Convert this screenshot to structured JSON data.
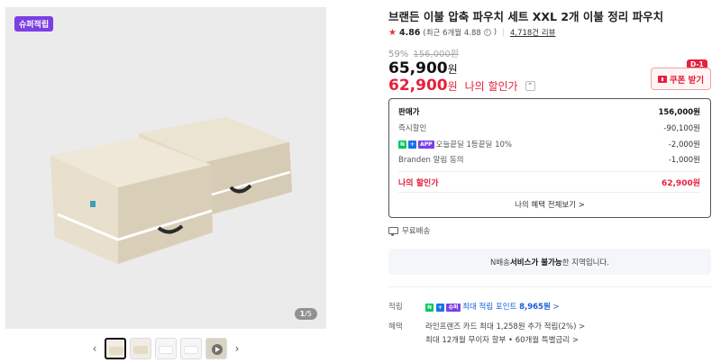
{
  "gallery": {
    "badge": "슈퍼적립",
    "counter_current": "1",
    "counter_total": "/5",
    "prev_icon": "chevron-left-icon",
    "next_icon": "chevron-right-icon",
    "thumbnails": [
      {
        "kind": "beige",
        "active": true
      },
      {
        "kind": "beige",
        "active": false
      },
      {
        "kind": "white",
        "active": false
      },
      {
        "kind": "white",
        "active": false
      },
      {
        "kind": "video",
        "active": false
      }
    ]
  },
  "product": {
    "title": "브랜든 이불 압축 파우치 세트 XXL 2개 이불 정리 파우치",
    "rating": "4.86",
    "rating_detail": "(최근 6개월 4.88",
    "rating_detail_close": ")",
    "review_count": "4,718건 리뷰",
    "discount_rate": "59%",
    "original_price": "156,000원",
    "price": "65,900",
    "price_unit": "원",
    "my_price": "62,900",
    "my_price_unit": "원",
    "my_price_label": "나의 할인가",
    "coupon_button": "쿠폰 받기",
    "dday_badge": "D-1"
  },
  "breakdown": {
    "rows": [
      {
        "label": "판매가",
        "value": "156,000원"
      },
      {
        "label": "즉시할인",
        "value": "-90,100원"
      },
      {
        "label": "오늘끝딜 1등끝딜 10%",
        "value": "-2,000원"
      },
      {
        "label": "Branden 알림 동의",
        "value": "-1,000원"
      }
    ],
    "my_label": "나의 할인가",
    "my_value": "62,900원",
    "badge_n": "N",
    "badge_plus": "+",
    "badge_app": "APP",
    "view_all": "나의 혜택 전체보기 >"
  },
  "shipping": {
    "text": "무료배송"
  },
  "n_delivery": {
    "prefix": "N배송 ",
    "strong": "서비스가 불가능",
    "suffix": "한 지역입니다."
  },
  "benefits": {
    "points_label": "적립",
    "points_badge_super": "슈퍼",
    "points_text": "최대 적립 포인트",
    "points_value": "8,965원",
    "points_arrow": ">",
    "benefit_label": "혜택",
    "card_text": "라인프렌즈 카드 최대 1,258원 추가 적립(2%) >",
    "installment_text": "최대 12개월 무이자 할부 • 60개월 특별금리 >"
  },
  "colors": {
    "accent_red": "#e5213c",
    "super_badge": "#7b3fe4",
    "naver_green": "#03c75a",
    "points_blue": "#1a5cd6"
  }
}
